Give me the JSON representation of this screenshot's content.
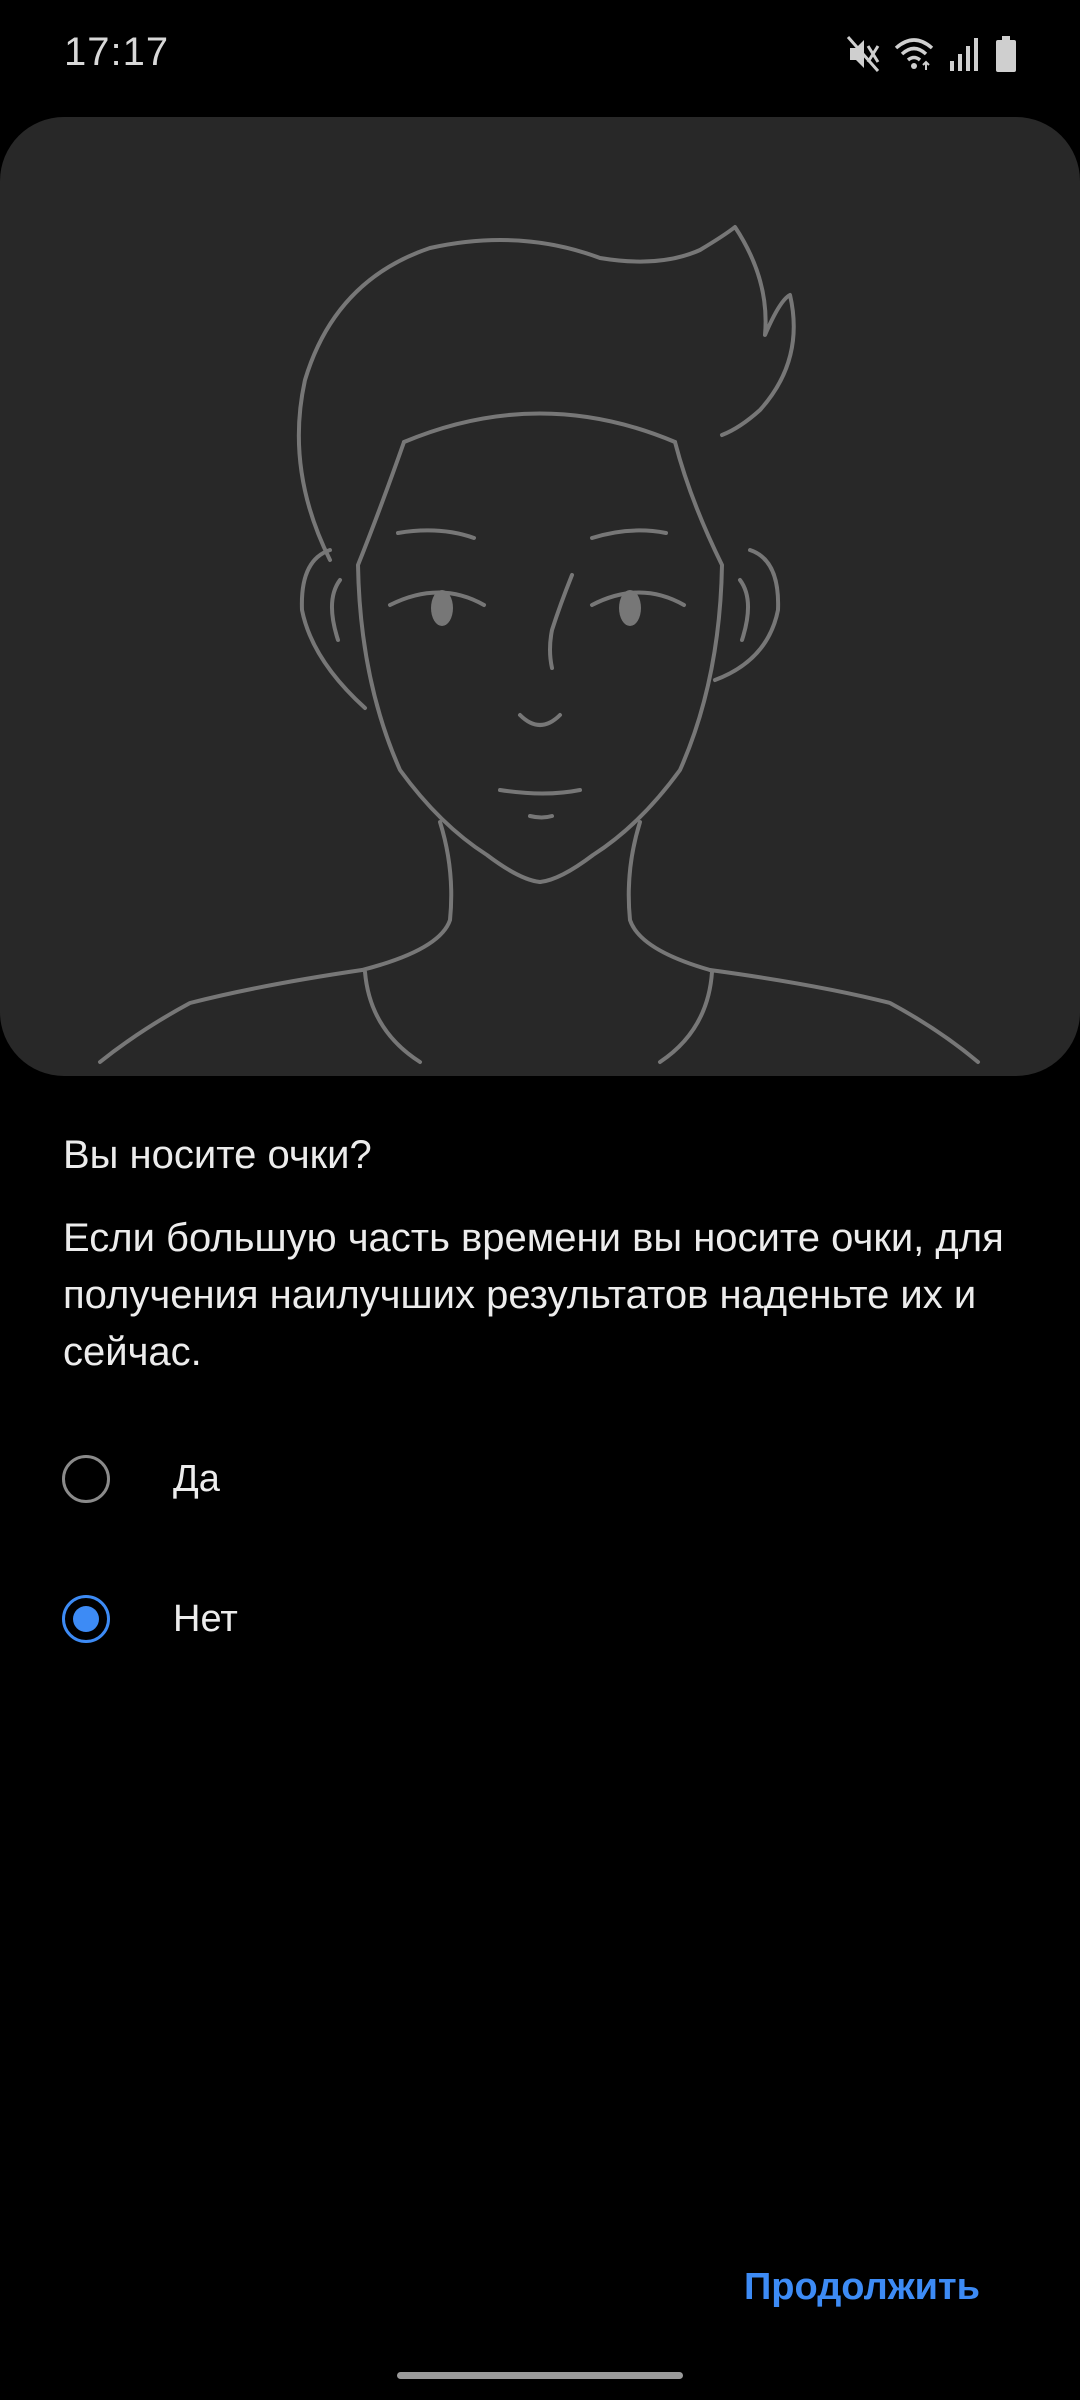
{
  "status_bar": {
    "time": "17:17",
    "icons": [
      "mute-icon",
      "wifi-icon",
      "signal-icon",
      "battery-icon"
    ]
  },
  "illustration": {
    "icon": "face-outline-illustration"
  },
  "question": {
    "title": "Вы носите очки?",
    "description": "Если большую часть времени вы носите очки, для получения наилучших результатов наденьте их и сейчас."
  },
  "options": [
    {
      "label": "Да",
      "selected": false
    },
    {
      "label": "Нет",
      "selected": true
    }
  ],
  "footer": {
    "continue_label": "Продолжить"
  },
  "colors": {
    "accent": "#3d8bf5",
    "background": "#000000",
    "card": "#282828"
  }
}
